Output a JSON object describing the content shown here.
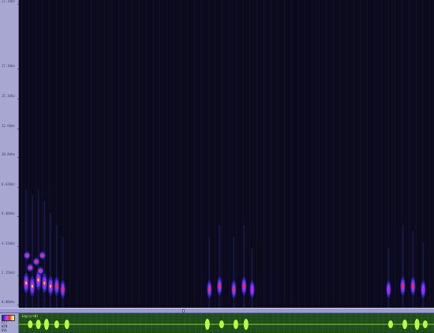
{
  "window": {
    "title": ""
  },
  "frequency_axis": {
    "ticks": [
      {
        "label": "22.1kHz",
        "freq": 22.1
      },
      {
        "label": "17.3kHz",
        "freq": 17.3
      },
      {
        "label": "15.1kHz",
        "freq": 15.1
      },
      {
        "label": "12.9kHz",
        "freq": 12.9
      },
      {
        "label": "10.8kHz",
        "freq": 10.8
      },
      {
        "label": "8.62kHz",
        "freq": 8.62
      },
      {
        "label": "6.46kHz",
        "freq": 6.46
      },
      {
        "label": "4.31kHz",
        "freq": 4.31
      },
      {
        "label": "2.15kHz",
        "freq": 2.15
      },
      {
        "label": "0.00kHz",
        "freq": 0.0
      }
    ]
  },
  "spectrogram": {
    "calls": [
      {
        "t": 0.01,
        "f": 0.08,
        "intensity": 1.0
      },
      {
        "t": 0.025,
        "f": 0.07,
        "intensity": 0.95
      },
      {
        "t": 0.04,
        "f": 0.09,
        "intensity": 1.0
      },
      {
        "t": 0.055,
        "f": 0.08,
        "intensity": 0.9
      },
      {
        "t": 0.07,
        "f": 0.07,
        "intensity": 0.8
      },
      {
        "t": 0.085,
        "f": 0.07,
        "intensity": 0.7
      },
      {
        "t": 0.1,
        "f": 0.06,
        "intensity": 0.6
      },
      {
        "t": 0.46,
        "f": 0.06,
        "intensity": 0.6
      },
      {
        "t": 0.485,
        "f": 0.07,
        "intensity": 0.7
      },
      {
        "t": 0.52,
        "f": 0.06,
        "intensity": 0.6
      },
      {
        "t": 0.545,
        "f": 0.07,
        "intensity": 0.7
      },
      {
        "t": 0.565,
        "f": 0.06,
        "intensity": 0.5
      },
      {
        "t": 0.9,
        "f": 0.06,
        "intensity": 0.5
      },
      {
        "t": 0.935,
        "f": 0.07,
        "intensity": 0.7
      },
      {
        "t": 0.96,
        "f": 0.07,
        "intensity": 0.65
      },
      {
        "t": 0.985,
        "f": 0.06,
        "intensity": 0.55
      }
    ]
  },
  "scrollbar": {
    "position": 0.42
  },
  "overview": {
    "caption": "1og(s/s0)",
    "labels": [
      "FFT",
      "WIN",
      "OVL"
    ],
    "bursts": [
      0.02,
      0.04,
      0.06,
      0.085,
      0.11,
      0.455,
      0.49,
      0.525,
      0.55,
      0.905,
      0.94,
      0.97,
      0.99
    ]
  },
  "colors": {
    "background": "#0a0a1c",
    "axis_panel": "#a7a7d2",
    "waveform_bg": "#1f4a1a",
    "waveform": "#b8ff3a"
  }
}
